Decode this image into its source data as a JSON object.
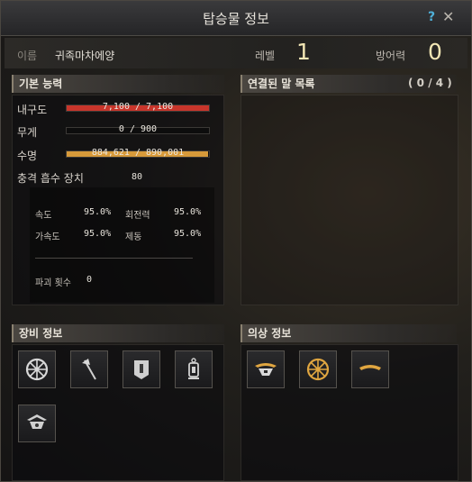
{
  "window": {
    "title": "탑승물 정보",
    "help": "?",
    "close": "✕"
  },
  "info": {
    "name_label": "이름",
    "name_value": "귀족마차에양",
    "level_label": "레벨",
    "level_value": "1",
    "defense_label": "방어력",
    "defense_value": "0"
  },
  "basic": {
    "header": "기본 능력",
    "durability": {
      "label": "내구도",
      "text": "7,100 / 7,100",
      "fraction": 1.0,
      "color": "#c8352b"
    },
    "weight": {
      "label": "무게",
      "text": "0 / 900",
      "fraction": 0.0,
      "color": "#888888"
    },
    "lifespan": {
      "label": "수명",
      "text": "884,621 / 890,001",
      "fraction": 0.994,
      "color": "#d79a3a"
    },
    "shock": {
      "label": "충격 흡수 장치",
      "value": "80"
    },
    "speed_label": "속도",
    "speed_value": "95.0%",
    "turn_label": "회전력",
    "turn_value": "95.0%",
    "accel_label": "가속도",
    "accel_value": "95.0%",
    "brake_label": "제동",
    "brake_value": "95.0%",
    "destroy_label": "파괴 횟수",
    "destroy_value": "0"
  },
  "linked": {
    "header": "연결된 말 목록",
    "count": "( 0 / 4 )"
  },
  "equipment": {
    "header": "장비 정보",
    "slots": [
      "wheel-icon",
      "axe-icon",
      "banner-icon",
      "lantern-icon",
      "flag-icon"
    ]
  },
  "costume": {
    "header": "의상 정보",
    "slots": [
      "canopy-icon",
      "wheel-icon",
      "ornament-icon"
    ]
  }
}
